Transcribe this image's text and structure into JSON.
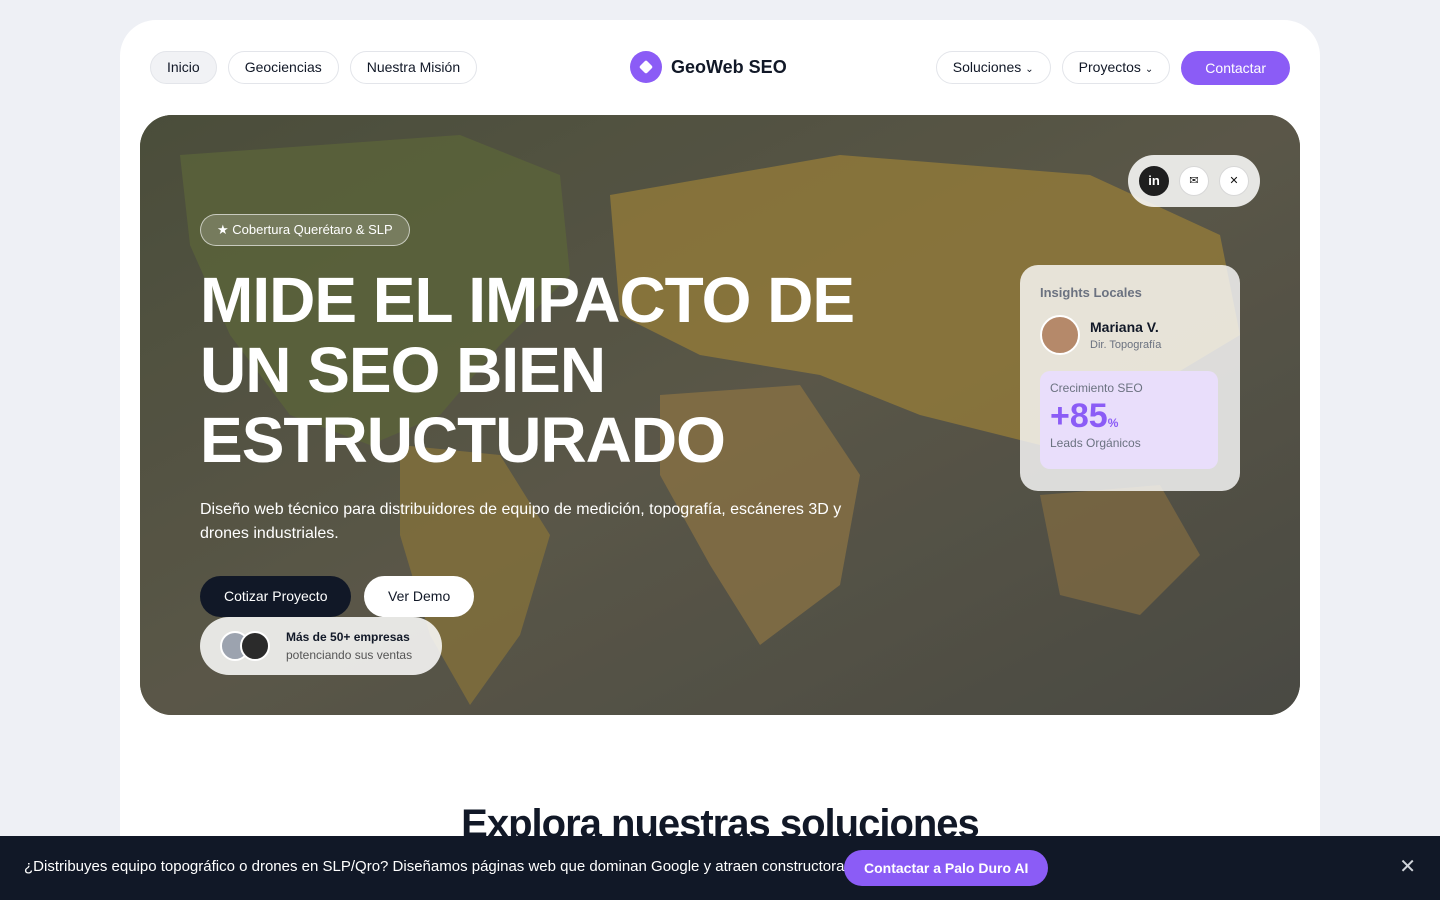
{
  "nav": {
    "left": [
      "Inicio",
      "Geociencias",
      "Nuestra Misión"
    ],
    "brand": "GeoWeb SEO",
    "right": [
      {
        "label": "Soluciones",
        "chevron": "⌄"
      },
      {
        "label": "Proyectos",
        "chevron": "⌄"
      }
    ],
    "contact": "Contactar"
  },
  "hero": {
    "badge": "★ Cobertura Querétaro & SLP",
    "headline": [
      "MIDE EL IMPACTO DE",
      "UN SEO BIEN",
      "ESTRUCTURADO"
    ],
    "subtitle": "Diseño web técnico para distribuidores de equipo de medición, topografía, escáneres 3D y drones industriales.",
    "cta_primary": "Cotizar Proyecto",
    "cta_secondary": "Ver Demo",
    "proof_title": "Más de 50+ empresas",
    "proof_sub": "potenciando sus ventas",
    "social": {
      "linkedin": "in",
      "email": "✉",
      "x": "✕"
    }
  },
  "insights": {
    "title": "Insights Locales",
    "name": "Mariana V.",
    "role": "Dir. Topografía",
    "metric_label": "Crecimiento SEO",
    "metric_value": "+85",
    "metric_unit": "%",
    "metric_sub": "Leads Orgánicos"
  },
  "section": {
    "title": "Explora nuestras soluciones"
  },
  "banner": {
    "text": "¿Distribuyes equipo topográfico o drones en SLP/Qro? Diseñamos páginas web que dominan Google y atraen constructoras.",
    "button": "Contactar a Palo Duro AI",
    "close": "✕"
  },
  "colors": {
    "accent": "#8b5cf6",
    "dark": "#111827"
  }
}
